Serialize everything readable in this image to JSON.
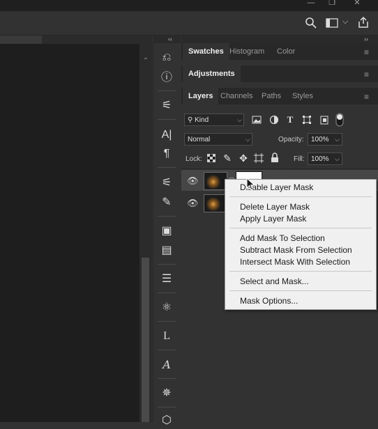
{
  "window": {
    "buttons": [
      "minimize-icon",
      "restore-icon",
      "close-icon"
    ],
    "minimize_glyph": "—",
    "restore_glyph": "❐",
    "close_glyph": "✕"
  },
  "options_bar": {
    "icons": [
      "search-icon",
      "workspace-icon",
      "chevron-down-icon",
      "share-icon"
    ],
    "search_glyph": "⚲",
    "chevron_glyph": "⌵"
  },
  "collapse_glyph": "‹‹",
  "expand_glyph": "››",
  "scroll_up_glyph": "⌃",
  "tools": [
    {
      "name": "history-icon",
      "glyph": "⎌"
    },
    {
      "name": "info-icon",
      "glyph": "ⓘ"
    },
    {
      "name": "clone-source-icon",
      "glyph": "⚟"
    },
    {
      "name": "character-icon",
      "glyph": "A|"
    },
    {
      "name": "paragraph-icon",
      "glyph": "¶"
    },
    {
      "name": "brush-settings-icon",
      "glyph": "⚟"
    },
    {
      "name": "brushes-icon",
      "glyph": "✎"
    },
    {
      "name": "libraries-icon",
      "glyph": "▣"
    },
    {
      "name": "notes-icon",
      "glyph": "▤"
    },
    {
      "name": "properties-icon",
      "glyph": "☰"
    },
    {
      "name": "3d-icon",
      "glyph": "⚛"
    },
    {
      "name": "layer-comps-icon",
      "glyph": "L"
    },
    {
      "name": "glyphs-icon",
      "glyph": "𝐴"
    },
    {
      "name": "navigator-icon",
      "glyph": "✵"
    },
    {
      "name": "3d-object-icon",
      "glyph": "⬡"
    }
  ],
  "panel_group_1": {
    "tabs": [
      "Swatches",
      "Histogram",
      "Color"
    ],
    "active": "Swatches",
    "menu_glyph": "≡"
  },
  "panel_group_2": {
    "tabs": [
      "Adjustments"
    ],
    "active": "Adjustments",
    "menu_glyph": "≡"
  },
  "panel_group_3": {
    "tabs": [
      "Layers",
      "Channels",
      "Paths",
      "Styles"
    ],
    "active": "Layers",
    "menu_glyph": "≡"
  },
  "layers": {
    "filter_kind": "Kind",
    "filter_icons": [
      "image-filter-icon",
      "adjustment-filter-icon",
      "type-filter-icon",
      "shape-filter-icon",
      "smart-object-filter-icon",
      "filter-toggle-icon"
    ],
    "blend_mode": "Normal",
    "opacity_label": "Opacity:",
    "opacity_value": "100%",
    "lock_label": "Lock:",
    "lock_icons": [
      "lock-transparent-icon",
      "lock-image-icon",
      "lock-position-icon",
      "lock-artboard-icon",
      "lock-all-icon"
    ],
    "fill_label": "Fill:",
    "fill_value": "100%",
    "rows": [
      {
        "visible_glyph": "👁"
      },
      {
        "visible_glyph": "👁"
      }
    ]
  },
  "context_menu": {
    "items": [
      "Disable Layer Mask",
      "Delete Layer Mask",
      "Apply Layer Mask",
      "Add Mask To Selection",
      "Subtract Mask From Selection",
      "Intersect Mask With Selection",
      "Select and Mask...",
      "Mask Options..."
    ]
  },
  "colors": {
    "accent_panel": "#323232",
    "canvas": "#1e1e1e",
    "menu_bg": "#f0f0f0"
  }
}
